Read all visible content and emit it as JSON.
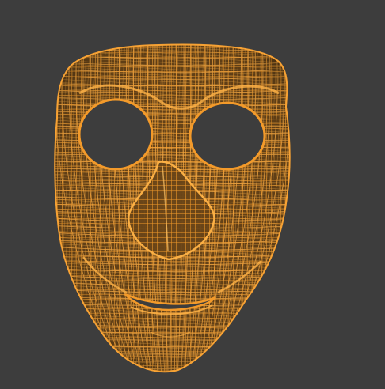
{
  "viewport": {
    "background_color": "#3d3d3d"
  },
  "mesh": {
    "display_mode": "wireframe",
    "subject": "mask",
    "wire_color": "#f39a2a",
    "wire_dark_color": "#c86f10"
  }
}
